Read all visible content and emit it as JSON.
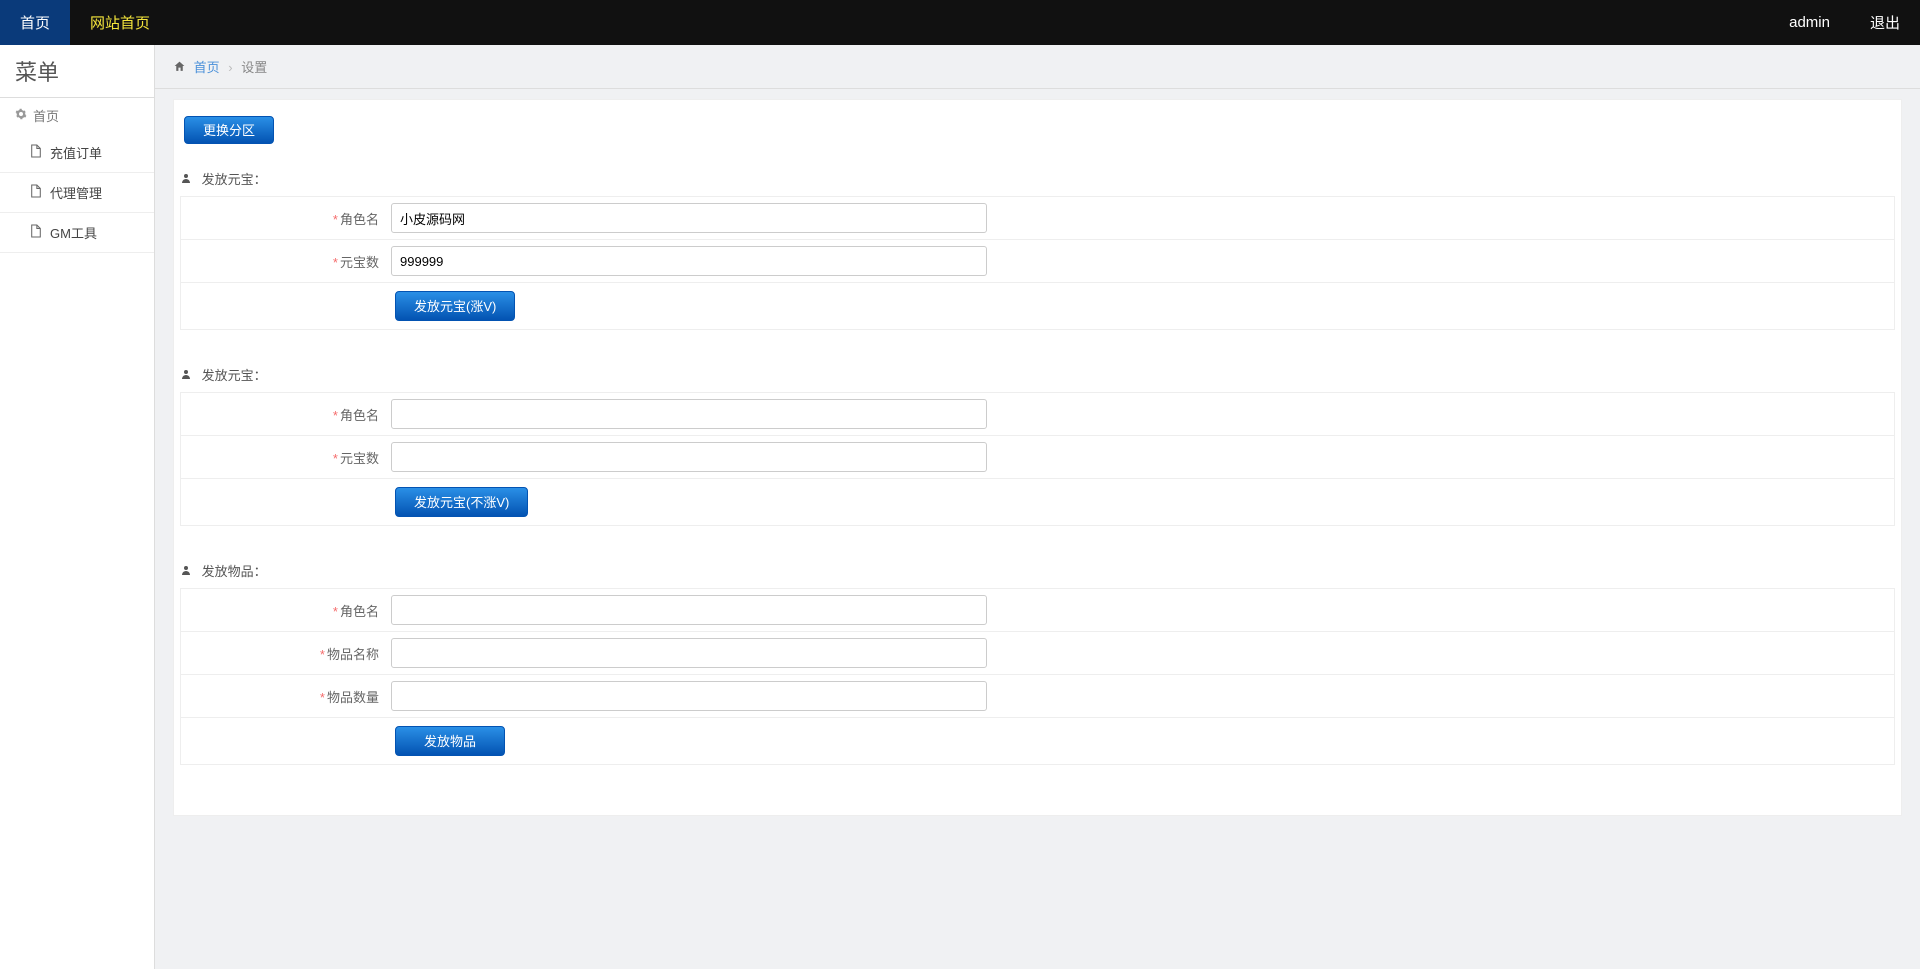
{
  "topbar": {
    "home_label": "首页",
    "site_label": "网站首页",
    "user_label": "admin",
    "logout_label": "退出"
  },
  "sidebar": {
    "title": "菜单",
    "group_label": "首页",
    "items": [
      {
        "label": "充值订单"
      },
      {
        "label": "代理管理"
      },
      {
        "label": "GM工具"
      }
    ]
  },
  "breadcrumb": {
    "home_label": "首页",
    "current_label": "设置"
  },
  "switch_zone_label": "更换分区",
  "sections": [
    {
      "title": "发放元宝：",
      "fields": [
        {
          "label": "角色名",
          "value": "小皮源码网"
        },
        {
          "label": "元宝数",
          "value": "999999"
        }
      ],
      "button": "发放元宝(涨V)"
    },
    {
      "title": "发放元宝：",
      "fields": [
        {
          "label": "角色名",
          "value": ""
        },
        {
          "label": "元宝数",
          "value": ""
        }
      ],
      "button": "发放元宝(不涨V)"
    },
    {
      "title": "发放物品：",
      "fields": [
        {
          "label": "角色名",
          "value": ""
        },
        {
          "label": "物品名称",
          "value": ""
        },
        {
          "label": "物品数量",
          "value": ""
        }
      ],
      "button": "发放物品"
    }
  ]
}
